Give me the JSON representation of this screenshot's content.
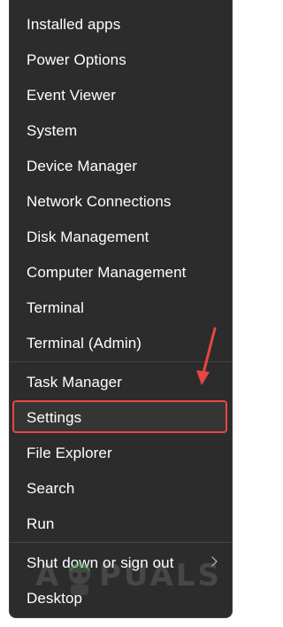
{
  "menu": {
    "items": [
      {
        "label": "Installed apps"
      },
      {
        "label": "Power Options"
      },
      {
        "label": "Event Viewer"
      },
      {
        "label": "System"
      },
      {
        "label": "Device Manager"
      },
      {
        "label": "Network Connections"
      },
      {
        "label": "Disk Management"
      },
      {
        "label": "Computer Management"
      },
      {
        "label": "Terminal"
      },
      {
        "label": "Terminal (Admin)"
      },
      {
        "label": "Task Manager"
      },
      {
        "label": "Settings"
      },
      {
        "label": "File Explorer"
      },
      {
        "label": "Search"
      },
      {
        "label": "Run"
      },
      {
        "label": "Shut down or sign out"
      },
      {
        "label": "Desktop"
      }
    ],
    "highlighted_item": "Settings",
    "submenu_icon": "chevron-right-icon"
  },
  "annotation": {
    "color": "#e84545",
    "icon": "red-arrow-icon"
  },
  "watermark": {
    "text_left": "A",
    "text_right": "PUALS",
    "icon": "appuals-mascot-icon"
  },
  "colors": {
    "menu_background": "#2c2c2c",
    "text": "#ffffff",
    "highlight_border": "#e84545"
  }
}
